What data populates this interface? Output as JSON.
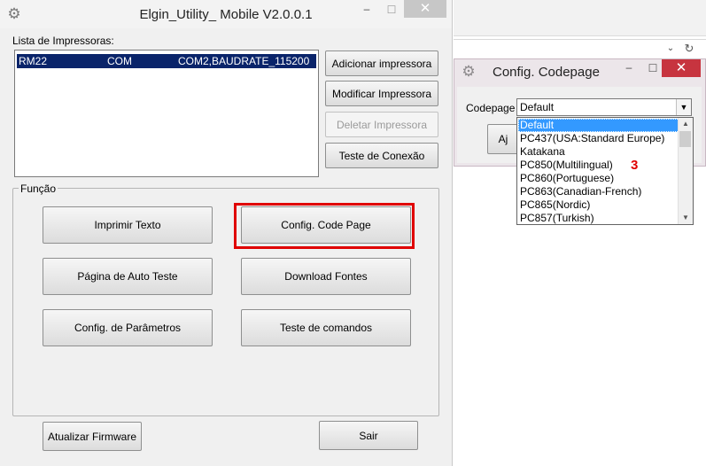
{
  "main_window": {
    "title": "Elgin_Utility_ Mobile  V2.0.0.1",
    "minimize": "–",
    "maximize": "☐",
    "close": "✕"
  },
  "printers": {
    "label": "Lista de Impressoras:",
    "rows": [
      {
        "name": "RM22",
        "type": "COM",
        "config": "COM2,BAUDRATE_115200"
      }
    ]
  },
  "printer_buttons": {
    "add": "Adicionar impressora",
    "modify": "Modificar Impressora",
    "delete": "Deletar Impressora",
    "test": "Teste de Conexão"
  },
  "function_group": {
    "label": "Função",
    "buttons": {
      "print_text": "Imprimir Texto",
      "code_page": "Config. Code Page",
      "self_test": "Página de Auto Teste",
      "download_fonts": "Download Fontes",
      "params": "Config. de Parâmetros",
      "commands": "Teste de comandos"
    }
  },
  "bottom": {
    "firmware": "Atualizar Firmware",
    "exit": "Sair"
  },
  "codepage_dialog": {
    "title": "Config. Codepage",
    "minimize": "–",
    "maximize": "☐",
    "close": "✕",
    "label": "Codepage",
    "selected": "Default",
    "ok_partial": "Aj",
    "options": [
      "Default",
      "PC437(USA:Standard Europe)",
      "Katakana",
      "PC850(Multilingual)",
      "PC860(Portuguese)",
      "PC863(Canadian-French)",
      "PC865(Nordic)",
      "PC857(Turkish)"
    ]
  },
  "annotation": {
    "step": "3"
  },
  "colors": {
    "highlight_red": "#e00000",
    "selection_blue": "#0a246a",
    "dropdown_selection": "#3399ff",
    "close_red": "#c7343f"
  }
}
